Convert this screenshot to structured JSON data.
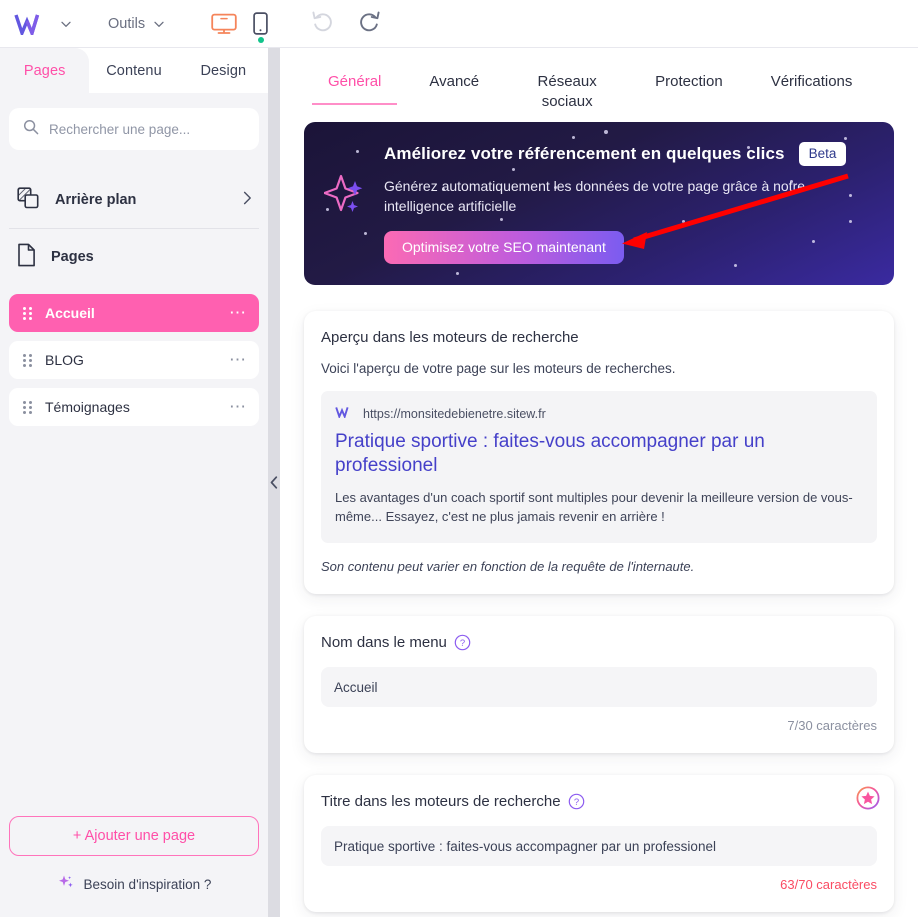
{
  "topbar": {
    "logo_alt": "Sitew W logo",
    "logo_caret": "chevron-down",
    "tools_label": "Outils",
    "tools_caret": "chevron-down",
    "desktop_icon": "monitor-icon",
    "mobile_icon": "smartphone-icon",
    "mobile_status_dot": "#12c48b",
    "undo_icon": "undo-icon",
    "redo_icon": "redo-icon"
  },
  "sidebar": {
    "tabs": [
      {
        "label": "Pages",
        "active": true
      },
      {
        "label": "Contenu",
        "active": false
      },
      {
        "label": "Design",
        "active": false
      }
    ],
    "search": {
      "placeholder": "Rechercher une page...",
      "value": "",
      "icon": "search-icon"
    },
    "background_row": {
      "label": "Arrière plan",
      "icon": "layers-icon",
      "chevron": "chevron-right-icon"
    },
    "pages_row": {
      "label": "Pages",
      "icon": "document-icon"
    },
    "pages": [
      {
        "label": "Accueil",
        "active": true
      },
      {
        "label": "BLOG",
        "active": false
      },
      {
        "label": "Témoignages",
        "active": false
      }
    ],
    "add_page_label": "+ Ajouter une page",
    "inspiration_label": "Besoin d'inspiration ?",
    "inspiration_icon": "sparkle-icon",
    "collapse_icon": "chevron-left-icon",
    "accent_pink": "#ff60b0"
  },
  "main": {
    "tabs": [
      {
        "label": "Général",
        "active": true
      },
      {
        "label": "Avancé",
        "active": false
      },
      {
        "label": "Réseaux sociaux",
        "active": false
      },
      {
        "label": "Protection",
        "active": false
      },
      {
        "label": "Vérifications",
        "active": false
      }
    ],
    "seo_banner": {
      "title": "Améliorez votre référencement en quelques clics",
      "badge": "Beta",
      "subtitle": "Générez automatiquement les données de votre page grâce à notre intelligence artificielle",
      "cta_label": "Optimisez votre SEO maintenant",
      "sparkle_icon": "sparkle-icon",
      "annotation_arrow": "red-arrow-pointing-to-cta"
    },
    "preview_card": {
      "title": "Aperçu dans les moteurs de recherche",
      "description": "Voici l'aperçu de votre page sur les moteurs de recherches.",
      "favicon": "sitew-w-icon",
      "url": "https://monsitedebienetre.sitew.fr",
      "result_title": "Pratique sportive : faites-vous accompagner par un professionel",
      "result_description": "Les avantages d'un coach sportif sont multiples pour devenir la meilleure version de vous-même... Essayez, c'est ne plus jamais revenir en arrière !",
      "note": "Son contenu peut varier en fonction de la requête de l'internaute."
    },
    "menu_name_card": {
      "title": "Nom dans le menu",
      "help_icon": "help-circle-icon",
      "value": "Accueil",
      "counter": "7/30 caractères"
    },
    "seo_title_card": {
      "title": "Titre dans les moteurs de recherche",
      "help_icon": "help-circle-icon",
      "premium_icon": "star-badge-icon",
      "value": "Pratique sportive : faites-vous accompagner par un professionel",
      "counter": "63/70 caractères",
      "counter_state": "warn"
    }
  }
}
